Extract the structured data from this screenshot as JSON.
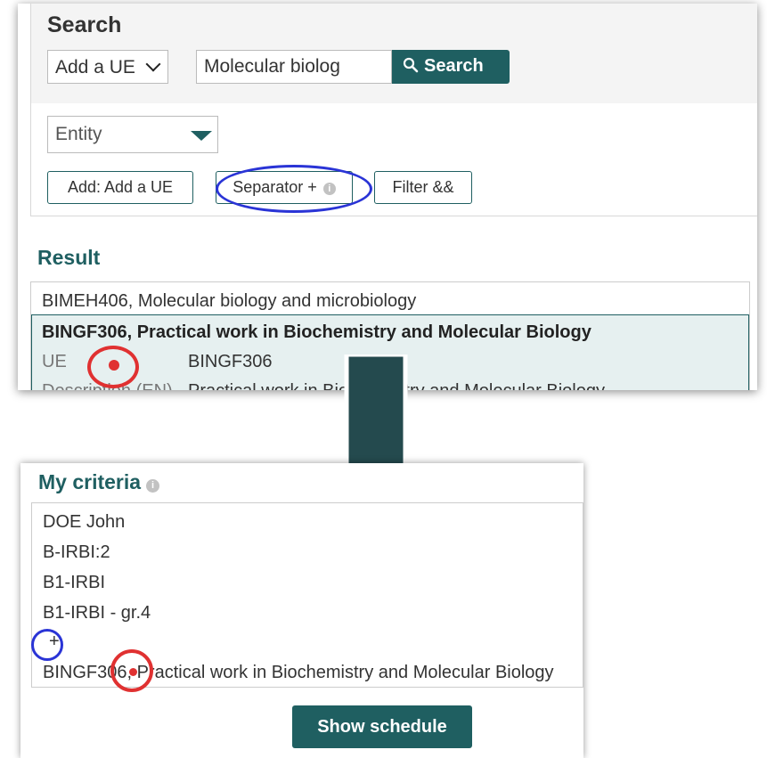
{
  "search": {
    "title": "Search",
    "type_select_value": "Add a UE",
    "query_value": "Molecular biolog",
    "search_button_label": "Search",
    "entity_select_value": "Entity",
    "add_button_label": "Add: Add a UE",
    "separator_button_label": "Separator +",
    "filter_button_label": "Filter &&"
  },
  "result": {
    "title": "Result",
    "items": [
      "BIMEH406, Molecular biology and microbiology"
    ],
    "selected": {
      "title": "BINGF306, Practical work in Biochemistry and Molecular Biology",
      "fields": [
        {
          "label": "UE",
          "value": "BINGF306"
        },
        {
          "label": "Description (EN)",
          "value": "Practical work in Biochemistry and Molecular Biology"
        }
      ]
    }
  },
  "criteria": {
    "title": "My criteria",
    "items": [
      "DOE John",
      "B-IRBI:2",
      "B1-IRBI",
      "B1-IRBI - gr.4",
      "+",
      "BINGF306, Practical work in Biochemistry and Molecular Biology"
    ],
    "show_schedule_label": "Show schedule"
  },
  "colors": {
    "primary": "#1f5f61",
    "annotation_blue": "#2a34d6",
    "annotation_red": "#e03131",
    "arrow": "#244a4e"
  },
  "icons": [
    "chevron-down-icon",
    "search-icon",
    "triangle-down-icon",
    "info-icon",
    "down-arrow-icon"
  ]
}
